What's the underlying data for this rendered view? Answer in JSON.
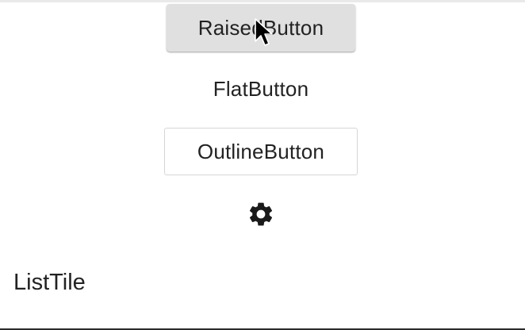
{
  "buttons": {
    "raised_label": "RaisedButton",
    "flat_label": "FlatButton",
    "outline_label": "OutlineButton"
  },
  "icon": {
    "name": "settings-gear-icon"
  },
  "list_tile": {
    "title": "ListTile"
  },
  "colors": {
    "raised_background": "#e0e0e0",
    "text": "#222222",
    "outline_border": "#d6d6d6",
    "icon": "#1a1a1a"
  }
}
